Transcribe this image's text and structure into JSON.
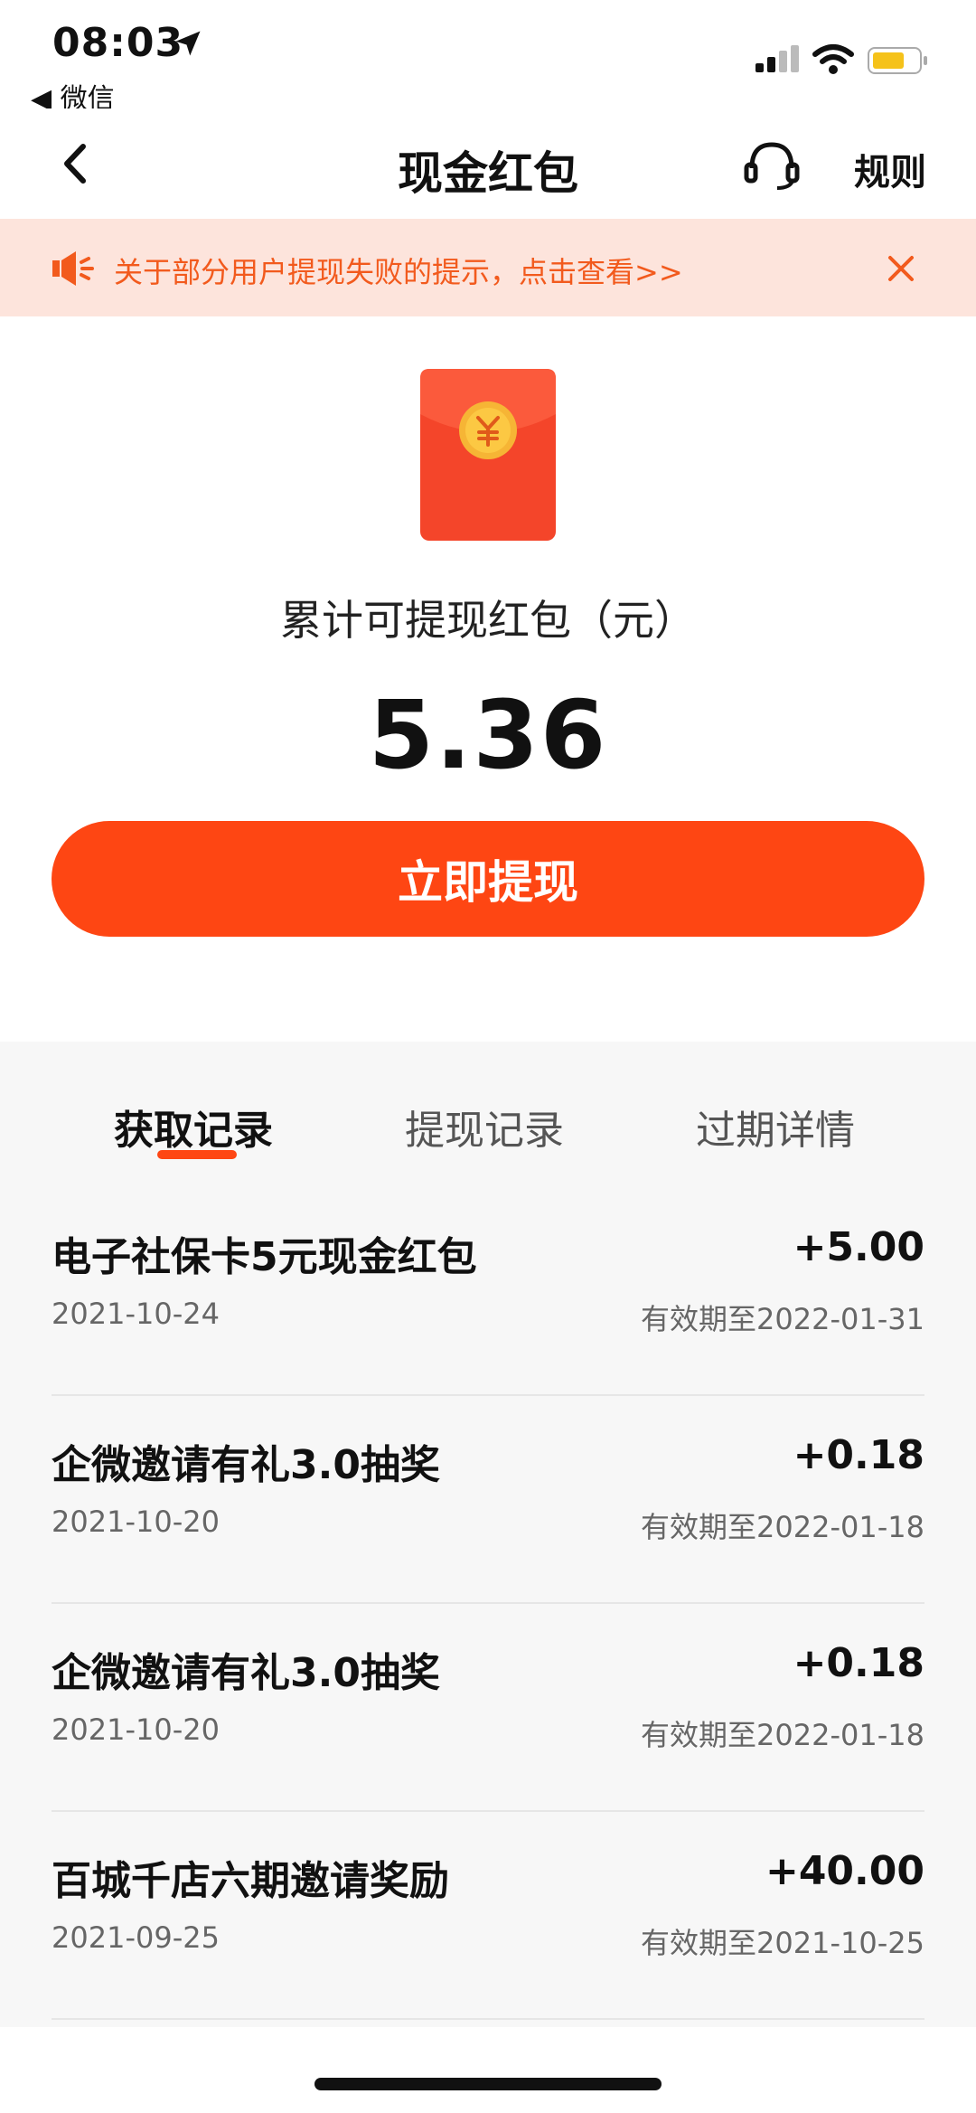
{
  "status_bar": {
    "time": "08:03",
    "back_app": "◀ 微信"
  },
  "nav": {
    "title": "现金红包",
    "rules": "规则"
  },
  "notice": {
    "text": "关于部分用户提现失败的提示，点击查看>>"
  },
  "balance": {
    "label": "累计可提现红包（元）",
    "amount": "5.36",
    "withdraw_label": "立即提现"
  },
  "tabs": [
    {
      "label": "获取记录",
      "active": true
    },
    {
      "label": "提现记录",
      "active": false
    },
    {
      "label": "过期详情",
      "active": false
    }
  ],
  "records": [
    {
      "title": "电子社保卡5元现金红包",
      "amount": "+5.00",
      "date": "2021-10-24",
      "expire": "有效期至2022-01-31"
    },
    {
      "title": "企微邀请有礼3.0抽奖",
      "amount": "+0.18",
      "date": "2021-10-20",
      "expire": "有效期至2022-01-18"
    },
    {
      "title": "企微邀请有礼3.0抽奖",
      "amount": "+0.18",
      "date": "2021-10-20",
      "expire": "有效期至2022-01-18"
    },
    {
      "title": "百城千店六期邀请奖励",
      "amount": "+40.00",
      "date": "2021-09-25",
      "expire": "有效期至2021-10-25"
    }
  ],
  "colors": {
    "accent": "#fe4613",
    "notice_bg": "#fde4dc",
    "notice_text": "#f25a1d",
    "records_bg": "#f7f7f7"
  }
}
